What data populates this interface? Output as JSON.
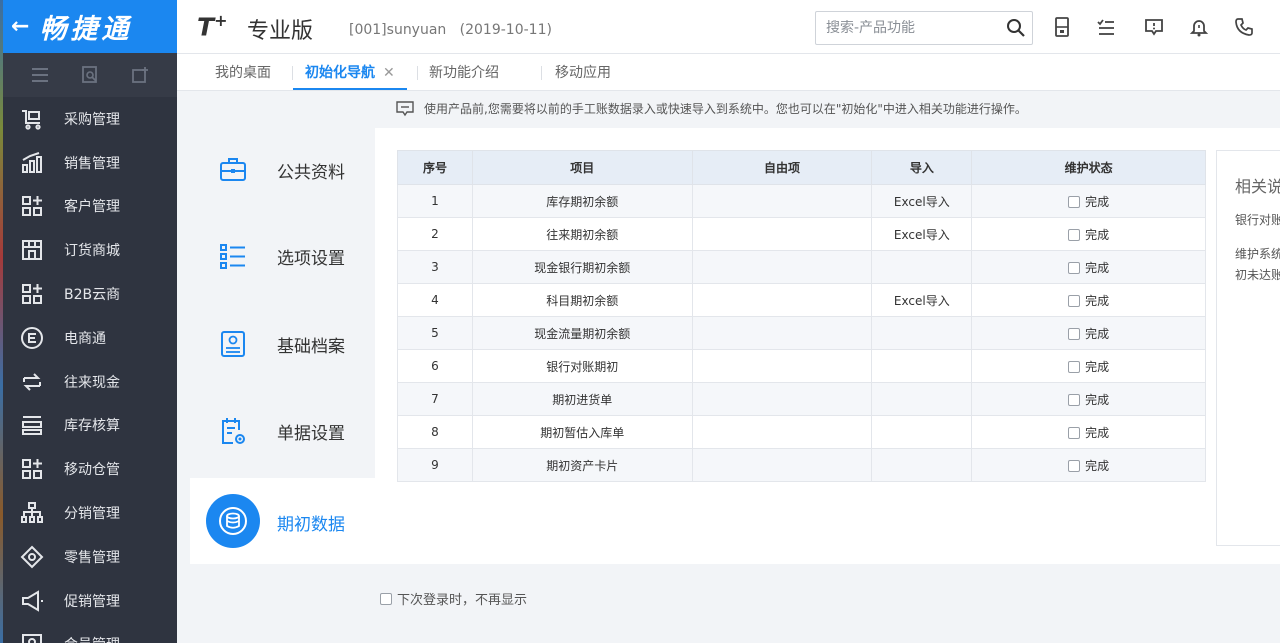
{
  "brand": {
    "back_glyph": "←",
    "name": "畅捷通"
  },
  "colors": {
    "primary": "#1b87f0",
    "sidebar_bg": "#2f3440",
    "header_bg": "#ffffff"
  },
  "header": {
    "logo": "T",
    "logo_sup": "+",
    "product": "专业版",
    "account": "[001]sunyuan",
    "date": "(2019-10-11)",
    "search_placeholder": "搜索-产品功能"
  },
  "sidebar": {
    "items": [
      {
        "label": "采购管理",
        "icon": "cart-icon"
      },
      {
        "label": "销售管理",
        "icon": "sales-chart-icon"
      },
      {
        "label": "客户管理",
        "icon": "grid-plus-icon"
      },
      {
        "label": "订货商城",
        "icon": "store-icon"
      },
      {
        "label": "B2B云商",
        "icon": "grid-plus-icon"
      },
      {
        "label": "电商通",
        "icon": "ecommerce-icon"
      },
      {
        "label": "往来现金",
        "icon": "transfer-icon"
      },
      {
        "label": "库存核算",
        "icon": "stack-icon"
      },
      {
        "label": "移动仓管",
        "icon": "grid-plus-icon"
      },
      {
        "label": "分销管理",
        "icon": "org-tree-icon"
      },
      {
        "label": "零售管理",
        "icon": "retail-icon"
      },
      {
        "label": "促销管理",
        "icon": "megaphone-icon"
      },
      {
        "label": "会员管理",
        "icon": "member-icon"
      }
    ]
  },
  "tabs": [
    {
      "label": "我的桌面"
    },
    {
      "label": "初始化导航",
      "close": "✕"
    },
    {
      "label": "新功能介绍"
    },
    {
      "label": "移动应用"
    }
  ],
  "notice": "使用产品前,您需要将以前的手工账数据录入或快速导入到系统中。您也可以在\"初始化\"中进入相关功能进行操作。",
  "left_nav": {
    "items": [
      {
        "label": "公共资料",
        "icon": "briefcase-icon"
      },
      {
        "label": "选项设置",
        "icon": "checklist-icon"
      },
      {
        "label": "基础档案",
        "icon": "profile-card-icon"
      },
      {
        "label": "单据设置",
        "icon": "document-gear-icon"
      }
    ],
    "active": {
      "label": "期初数据",
      "icon": "database-icon"
    }
  },
  "table": {
    "headers": [
      "序号",
      "项目",
      "自由项",
      "导入",
      "维护状态"
    ],
    "status_label": "完成",
    "rows": [
      {
        "no": "1",
        "item": "库存期初余额",
        "free": "",
        "import": "Excel导入"
      },
      {
        "no": "2",
        "item": "往来期初余额",
        "free": "",
        "import": "Excel导入"
      },
      {
        "no": "3",
        "item": "现金银行期初余额",
        "free": "",
        "import": ""
      },
      {
        "no": "4",
        "item": "科目期初余额",
        "free": "",
        "import": "Excel导入"
      },
      {
        "no": "5",
        "item": "现金流量期初余额",
        "free": "",
        "import": ""
      },
      {
        "no": "6",
        "item": "银行对账期初",
        "free": "",
        "import": ""
      },
      {
        "no": "7",
        "item": "期初进货单",
        "free": "",
        "import": ""
      },
      {
        "no": "8",
        "item": "期初暂估入库单",
        "free": "",
        "import": ""
      },
      {
        "no": "9",
        "item": "期初资产卡片",
        "free": "",
        "import": ""
      }
    ]
  },
  "help": {
    "title": "相关说",
    "line1": "银行对账",
    "line2a": "维护系统",
    "line2b": "初未达账"
  },
  "footer": {
    "dont_show": "下次登录时，不再显示"
  }
}
